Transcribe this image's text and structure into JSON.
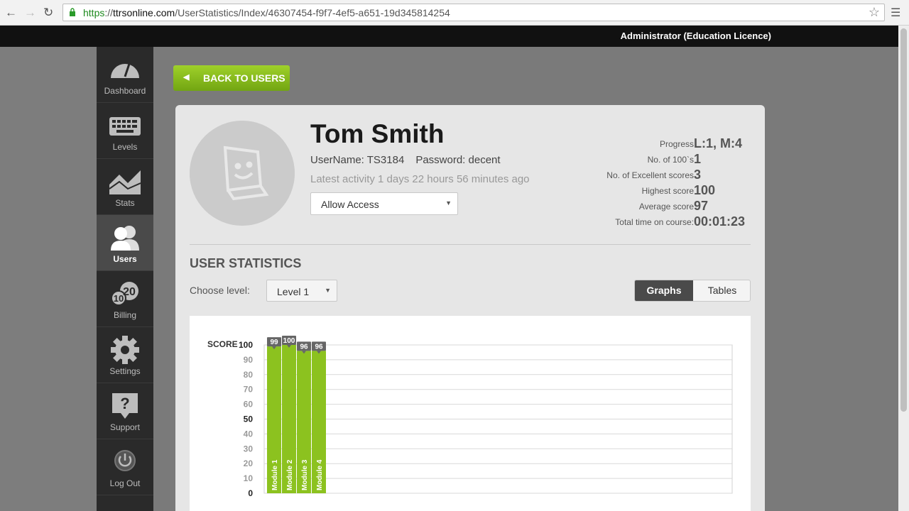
{
  "browser": {
    "url_scheme": "https",
    "url_host": "ttrsonline.com",
    "url_path": "/UserStatistics/Index/46307454-f9f7-4ef5-a651-19d345814254",
    "url_sep": "://"
  },
  "topbar": {
    "admin_label": "Administrator (Education Licence)"
  },
  "sidebar": {
    "items": [
      {
        "label": "Dashboard",
        "icon": "speedometer-icon"
      },
      {
        "label": "Levels",
        "icon": "keyboard-icon"
      },
      {
        "label": "Stats",
        "icon": "area-chart-icon"
      },
      {
        "label": "Users",
        "icon": "users-icon",
        "active": true
      },
      {
        "label": "Billing",
        "icon": "coins-icon"
      },
      {
        "label": "Settings",
        "icon": "gear-icon"
      },
      {
        "label": "Support",
        "icon": "question-icon"
      },
      {
        "label": "Log Out",
        "icon": "power-icon"
      }
    ],
    "billing_badge_a": "20",
    "billing_badge_b": "10"
  },
  "back_button": {
    "label": "BACK TO USERS"
  },
  "user": {
    "name": "Tom Smith",
    "username_label": "UserName:",
    "username": "TS3184",
    "password_label": "Password:",
    "password": "decent",
    "latest_activity": "Latest activity 1 days 22 hours 56 minutes ago",
    "access": "Allow Access"
  },
  "stats": [
    {
      "label": "Progress",
      "value": "L:1, M:4"
    },
    {
      "label": "No. of 100`s",
      "value": "1"
    },
    {
      "label": "No. of Excellent scores",
      "value": "3"
    },
    {
      "label": "Highest score",
      "value": "100"
    },
    {
      "label": "Average score",
      "value": "97"
    },
    {
      "label": "Total time on course:",
      "value": "00:01:23"
    }
  ],
  "section": {
    "title": "USER STATISTICS",
    "choose_level_label": "Choose level:",
    "level_value": "Level 1"
  },
  "view_toggle": {
    "graphs": "Graphs",
    "tables": "Tables",
    "active": "Graphs"
  },
  "chart_data": {
    "type": "bar",
    "ylabel": "SCORE",
    "categories": [
      "Module 1",
      "Module 2",
      "Module 3",
      "Module 4"
    ],
    "values": [
      99,
      100,
      96,
      96
    ],
    "ylim": [
      0,
      100
    ],
    "yticks": [
      0,
      10,
      20,
      30,
      40,
      50,
      60,
      70,
      80,
      90,
      100
    ],
    "grid": true,
    "bar_color": "#8cc21f"
  },
  "colors": {
    "accent_green": "#8cc21f",
    "sidebar_bg": "#2a2a2a",
    "topbar_bg": "#111111"
  }
}
